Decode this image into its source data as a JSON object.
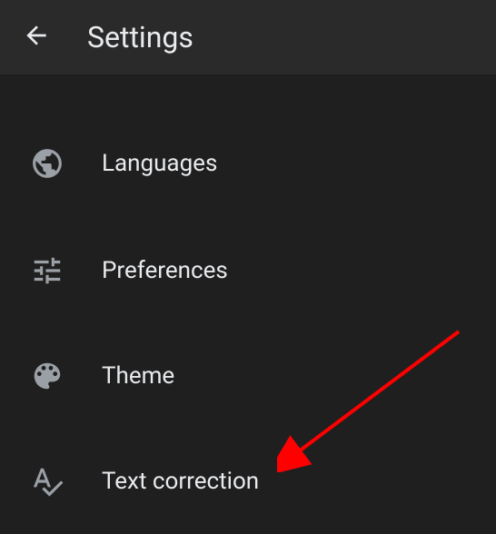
{
  "header": {
    "title": "Settings"
  },
  "menu": {
    "items": [
      {
        "label": "Languages",
        "icon": "globe-icon"
      },
      {
        "label": "Preferences",
        "icon": "sliders-icon"
      },
      {
        "label": "Theme",
        "icon": "palette-icon"
      },
      {
        "label": "Text correction",
        "icon": "text-check-icon"
      }
    ]
  }
}
